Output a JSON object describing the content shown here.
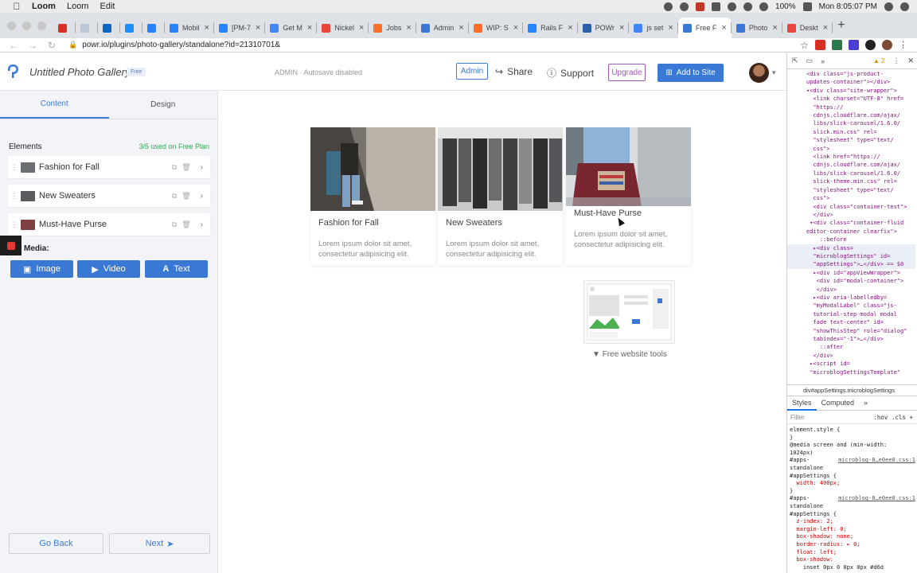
{
  "menubar": {
    "app": "Loom",
    "items": [
      "Loom",
      "Edit"
    ],
    "battery": "100%",
    "clock": "Mon 8:05:07 PM"
  },
  "browser": {
    "tabs": [
      {
        "label": "",
        "color": "#d93025",
        "active": false,
        "icon_only": true
      },
      {
        "label": "",
        "color": "#bcc8da",
        "active": false,
        "icon_only": true
      },
      {
        "label": "",
        "color": "#0a66c2",
        "active": false,
        "icon_only": true
      },
      {
        "label": "",
        "color": "#1f8fff",
        "active": false,
        "icon_only": true
      },
      {
        "label": "",
        "color": "#2684ff",
        "active": false,
        "icon_only": true
      },
      {
        "label": "Mobil",
        "color": "#2684ff",
        "active": false,
        "icon_only": false
      },
      {
        "label": "[PM-7",
        "color": "#2684ff",
        "active": false,
        "icon_only": false
      },
      {
        "label": "Get M",
        "color": "#4285f4",
        "active": false,
        "icon_only": false
      },
      {
        "label": "Nickel",
        "color": "#e8453c",
        "active": false,
        "icon_only": false
      },
      {
        "label": "Jobs",
        "color": "#fc6d26",
        "active": false,
        "icon_only": false
      },
      {
        "label": "Admin",
        "color": "#3a78d5",
        "active": false,
        "icon_only": false
      },
      {
        "label": "WIP: S",
        "color": "#fc6d26",
        "active": false,
        "icon_only": false
      },
      {
        "label": "Rails F",
        "color": "#2684ff",
        "active": false,
        "icon_only": false
      },
      {
        "label": "POWr",
        "color": "#2b5fa8",
        "active": false,
        "icon_only": false
      },
      {
        "label": "js set",
        "color": "#4285f4",
        "active": false,
        "icon_only": false
      },
      {
        "label": "Free F",
        "color": "#3a78d5",
        "active": true,
        "icon_only": false
      },
      {
        "label": "Photo",
        "color": "#3a78d5",
        "active": false,
        "icon_only": false
      },
      {
        "label": "Deskt",
        "color": "#e8453c",
        "active": false,
        "icon_only": false
      }
    ],
    "url": "powr.io/plugins/photo-gallery/standalone?id=21310701&"
  },
  "app": {
    "title": "Untitled Photo Gallery",
    "plan_badge": "Free",
    "status": "ADMIN · Autosave disabled",
    "admin_btn": "Admin",
    "share": "Share",
    "support": "Support",
    "upgrade": "Upgrade",
    "add_to_site": "Add to Site",
    "accent": "#3a78d5"
  },
  "sidebar": {
    "tabs": [
      "Content",
      "Design"
    ],
    "elements_label": "Elements",
    "elements_used": "3/5 used on Free Plan",
    "items": [
      {
        "name": "Fashion for Fall",
        "thumb": "#6b6f74"
      },
      {
        "name": "New Sweaters",
        "thumb": "#5a5c60"
      },
      {
        "name": "Must-Have Purse",
        "thumb": "#7e4040"
      }
    ],
    "add_media_label": "Media:",
    "media_buttons": [
      "Image",
      "Video",
      "Text"
    ],
    "go_back": "Go Back",
    "next": "Next"
  },
  "gallery": {
    "cards": [
      {
        "title": "Fashion for Fall",
        "desc": "Lorem ipsum dolor sit amet, consectetur adipisicing elit."
      },
      {
        "title": "New Sweaters",
        "desc": "Lorem ipsum dolor sit amet, consectetur adipisicing elit."
      },
      {
        "title": "Must-Have Purse",
        "desc": "Lorem ipsum dolor sit amet, consectetur adipisicing elit."
      }
    ],
    "promo_text": "Free website tools"
  },
  "devtools": {
    "warning_count": "2",
    "dom_lines": [
      {
        "text": "<div class=\"js-product-",
        "hl": false
      },
      {
        "text": "updates-container\"></div>",
        "hl": false
      },
      {
        "text": "▾<div class=\"site-wrapper\">",
        "hl": false
      },
      {
        "text": "  <link charset=\"UTF-8\" href=",
        "hl": false
      },
      {
        "text": "  \"https://",
        "hl": false
      },
      {
        "text": "  cdnjs.cloudflare.com/ajax/",
        "hl": false
      },
      {
        "text": "  libs/slick-carousel/1.6.0/",
        "hl": false
      },
      {
        "text": "  slick.min.css\" rel=",
        "hl": false
      },
      {
        "text": "  \"stylesheet\" type=\"text/",
        "hl": false
      },
      {
        "text": "  css\">",
        "hl": false
      },
      {
        "text": "  <link href=\"https://",
        "hl": false
      },
      {
        "text": "  cdnjs.cloudflare.com/ajax/",
        "hl": false
      },
      {
        "text": "  libs/slick-carousel/1.6.0/",
        "hl": false
      },
      {
        "text": "  slick-theme.min.css\" rel=",
        "hl": false
      },
      {
        "text": "  \"stylesheet\" type=\"text/",
        "hl": false
      },
      {
        "text": "  css\">",
        "hl": false
      },
      {
        "text": "  <div class=\"container-test\">",
        "hl": false
      },
      {
        "text": "  </div>",
        "hl": false
      },
      {
        "text": " ▾<div class=\"container-fluid",
        "hl": false
      },
      {
        "text": "editor-container clearfix\">",
        "hl": false
      },
      {
        "text": "    ::before",
        "hl": false
      },
      {
        "text": "  ▸<div class=",
        "hl": true
      },
      {
        "text": "  \"microblogSettings\" id=",
        "hl": true
      },
      {
        "text": "  \"appSettings\">…</div> == $0",
        "hl": true
      },
      {
        "text": "  ▸<div id=\"appViewWrapper\">",
        "hl": false
      },
      {
        "text": "   <div id=\"modal-container\">",
        "hl": false
      },
      {
        "text": "   </div>",
        "hl": false
      },
      {
        "text": "  ▸<div aria-labelledby=",
        "hl": false
      },
      {
        "text": "  \"myModalLabel\" class=\"js-",
        "hl": false
      },
      {
        "text": "  tutorial-step-modal modal",
        "hl": false
      },
      {
        "text": "  fade text-center\" id=",
        "hl": false
      },
      {
        "text": "  \"showThisStep\" role=\"dialog\"",
        "hl": false
      },
      {
        "text": "  tabindex=\"-1\">…</div>",
        "hl": false
      },
      {
        "text": "    ::after",
        "hl": false
      },
      {
        "text": "  </div>",
        "hl": false
      },
      {
        "text": " ▸<script id=",
        "hl": false
      },
      {
        "text": " \"microblogSettingsTemplate\"",
        "hl": false
      }
    ],
    "breadcrumb": "div#appSettings.microblogSettings",
    "tabs": [
      "Styles",
      "Computed"
    ],
    "filter_placeholder": "Filter",
    "filter_right": ":hov .cls +",
    "style_lines": [
      {
        "text": "element.style {",
        "src": "",
        "prop": false
      },
      {
        "text": "}",
        "src": "",
        "prop": false
      },
      {
        "text": "@media screen and (min-width:",
        "src": "",
        "prop": false
      },
      {
        "text": "1024px)",
        "src": "",
        "prop": false
      },
      {
        "text": "#apps-",
        "src": "microblog-8…e0ee0.css:1",
        "prop": false
      },
      {
        "text": "standalone",
        "src": "",
        "prop": false
      },
      {
        "text": "#appSettings {",
        "src": "",
        "prop": false
      },
      {
        "text": "  width: 400px;",
        "src": "",
        "prop": true
      },
      {
        "text": "}",
        "src": "",
        "prop": false
      },
      {
        "text": "#apps-",
        "src": "microblog-8…e0ee0.css:1",
        "prop": false
      },
      {
        "text": "standalone",
        "src": "",
        "prop": false
      },
      {
        "text": "#appSettings {",
        "src": "",
        "prop": false
      },
      {
        "text": "  z-index: 2;",
        "src": "",
        "prop": true
      },
      {
        "text": "  margin-left: 0;",
        "src": "",
        "prop": true
      },
      {
        "text": "  box-shadow: none;",
        "src": "",
        "prop": true
      },
      {
        "text": "  border-radius: ▸ 0;",
        "src": "",
        "prop": true
      },
      {
        "text": "  float: left;",
        "src": "",
        "prop": true
      },
      {
        "text": "  box-shadow:",
        "src": "",
        "prop": true
      },
      {
        "text": "    inset 0px 0 0px 0px #d6d",
        "src": "",
        "prop": false
      }
    ]
  }
}
